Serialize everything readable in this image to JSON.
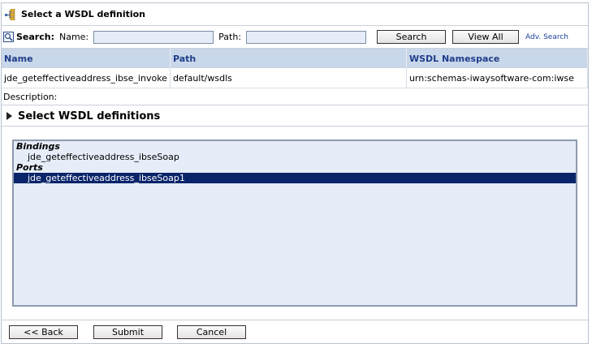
{
  "header": {
    "title": "Select a WSDL definition",
    "icon": "wsdl-tree-icon"
  },
  "search": {
    "label": "Search:",
    "name_label": "Name:",
    "name_value": "",
    "path_label": "Path:",
    "path_value": "",
    "search_button": "Search",
    "viewall_button": "View All",
    "advanced_link": "Adv. Search"
  },
  "results": {
    "columns": [
      "Name",
      "Path",
      "WSDL Namespace"
    ],
    "rows": [
      [
        "jde_geteffectiveaddress_ibse_invoke",
        "default/wsdls",
        "urn:schemas-iwaysoftware-com:iwse"
      ]
    ]
  },
  "description_label": "Description:",
  "section_title": "Select WSDL definitions",
  "wsdl_list": {
    "groups": [
      {
        "label": "Bindings",
        "items": [
          {
            "text": "jde_geteffectiveaddress_ibseSoap",
            "selected": false
          }
        ]
      },
      {
        "label": "Ports",
        "items": [
          {
            "text": "jde_geteffectiveaddress_ibseSoap1",
            "selected": true
          }
        ]
      }
    ]
  },
  "footer": {
    "back": "<< Back",
    "submit": "Submit",
    "cancel": "Cancel"
  },
  "colors": {
    "header_bg": "#c9d7ea",
    "header_text": "#1f3d8a",
    "selection": "#0a246a",
    "input_bg": "#e6edf8"
  }
}
